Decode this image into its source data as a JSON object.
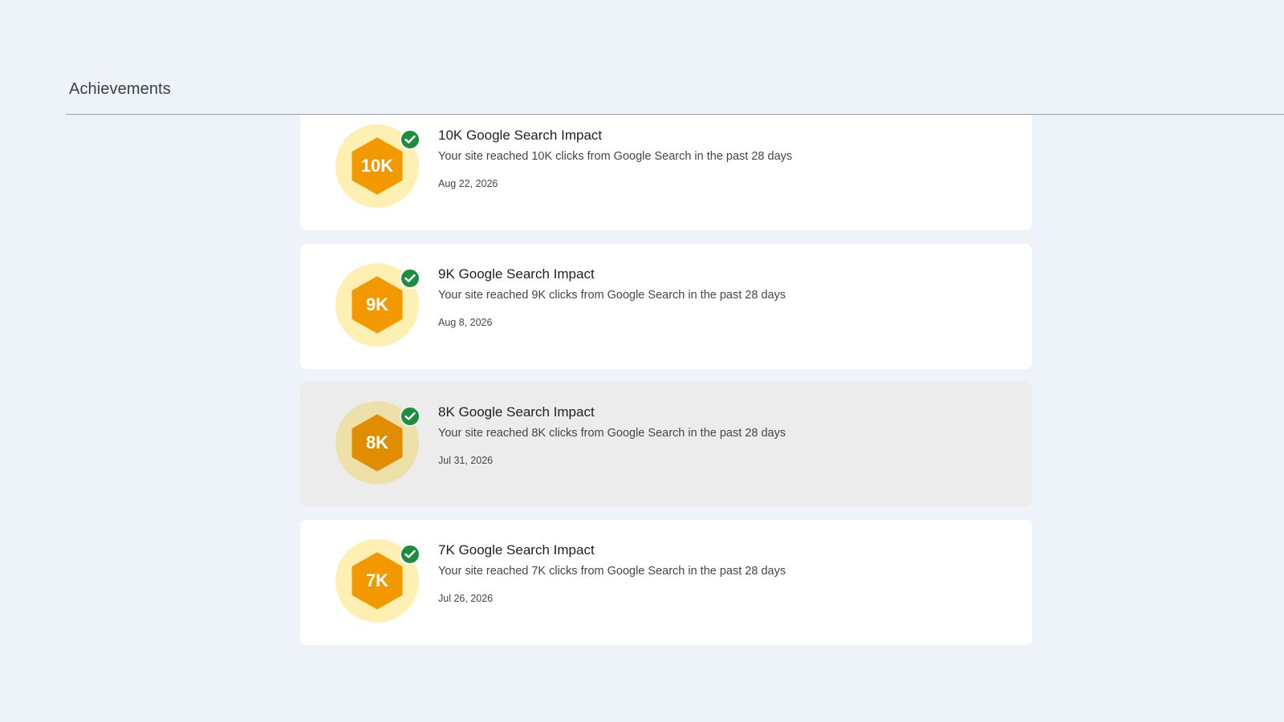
{
  "header": {
    "title": "Achievements"
  },
  "colors": {
    "background": "#eef2f9",
    "card": "#ffffff",
    "card_hover": "#ececec",
    "badge_circle": "#feefb2",
    "badge_hex": "#f29900",
    "check_green": "#1e8e3e"
  },
  "achievements": [
    {
      "badge": "10K",
      "title": "10K Google Search Impact",
      "description": "Your site reached 10K clicks from Google Search in the past 28 days",
      "date": "Aug 22, 2026",
      "completed_icon": "check-circle-icon"
    },
    {
      "badge": "9K",
      "title": "9K Google Search Impact",
      "description": "Your site reached 9K clicks from Google Search in the past 28 days",
      "date": "Aug 8, 2026",
      "completed_icon": "check-circle-icon"
    },
    {
      "badge": "8K",
      "title": "8K Google Search Impact",
      "description": "Your site reached 8K clicks from Google Search in the past 28 days",
      "date": "Jul 31, 2026",
      "completed_icon": "check-circle-icon"
    },
    {
      "badge": "7K",
      "title": "7K Google Search Impact",
      "description": "Your site reached 7K clicks from Google Search in the past 28 days",
      "date": "Jul 26, 2026",
      "completed_icon": "check-circle-icon"
    }
  ]
}
